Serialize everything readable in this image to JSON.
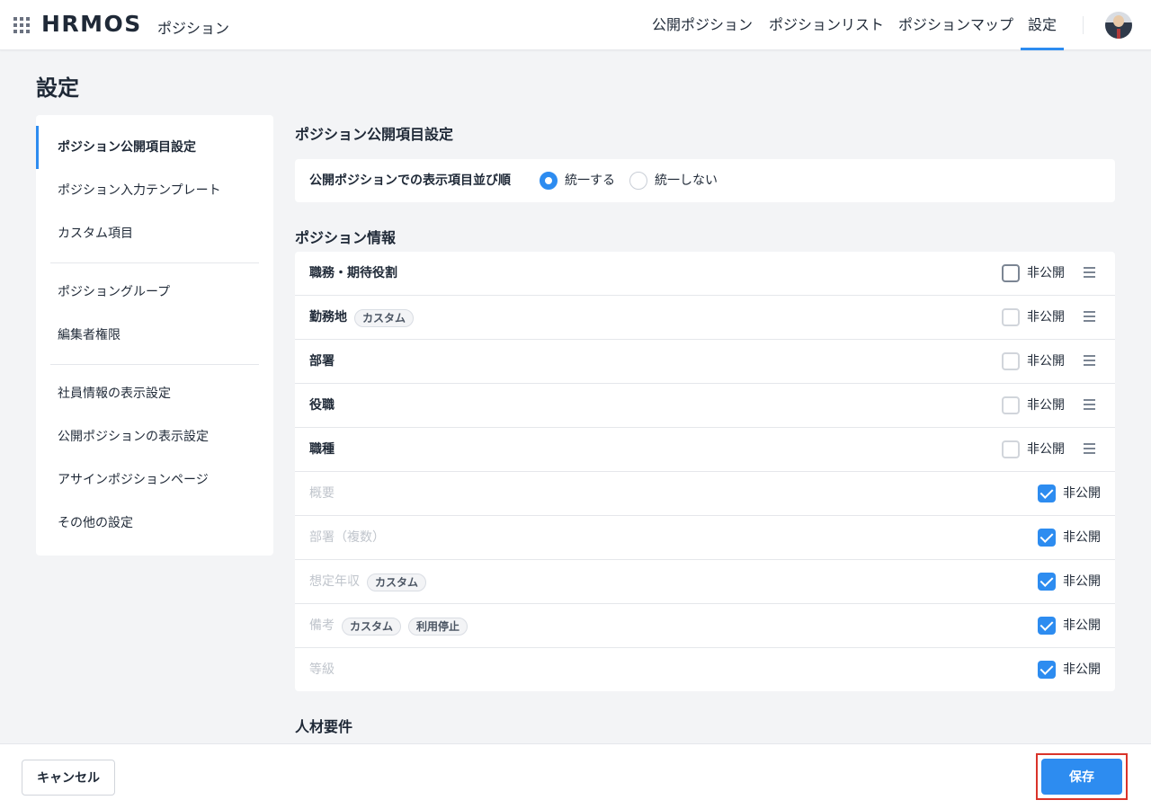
{
  "header": {
    "logo": "HRMOS",
    "app_name": "ポジション",
    "nav": [
      {
        "label": "公開ポジション",
        "active": false
      },
      {
        "label": "ポジションリスト",
        "active": false
      },
      {
        "label": "ポジションマップ",
        "active": false
      },
      {
        "label": "設定",
        "active": true
      }
    ]
  },
  "page_title": "設定",
  "sidebar": {
    "items": [
      {
        "label": "ポジション公開項目設定",
        "active": true
      },
      {
        "label": "ポジション入力テンプレート"
      },
      {
        "label": "カスタム項目"
      },
      {
        "label": "ポジショングループ"
      },
      {
        "label": "編集者権限"
      },
      {
        "label": "社員情報の表示設定"
      },
      {
        "label": "公開ポジションの表示設定"
      },
      {
        "label": "アサインポジションページ"
      },
      {
        "label": "その他の設定"
      }
    ]
  },
  "main": {
    "section_title": "ポジション公開項目設定",
    "order": {
      "label": "公開ポジションでの表示項目並び順",
      "options": [
        {
          "label": "統一する",
          "selected": true
        },
        {
          "label": "統一しない",
          "selected": false
        }
      ]
    },
    "position_info": {
      "title": "ポジション情報",
      "hidden_label": "非公開",
      "rows": [
        {
          "label": "職務・期待役割",
          "tags": [],
          "hidden": false,
          "disabled": false
        },
        {
          "label": "勤務地",
          "tags": [
            "カスタム"
          ],
          "hidden": false,
          "disabled": false
        },
        {
          "label": "部署",
          "tags": [],
          "hidden": false,
          "disabled": false
        },
        {
          "label": "役職",
          "tags": [],
          "hidden": false,
          "disabled": false
        },
        {
          "label": "職種",
          "tags": [],
          "hidden": false,
          "disabled": false
        },
        {
          "label": "概要",
          "tags": [],
          "hidden": true,
          "disabled": true
        },
        {
          "label": "部署（複数）",
          "tags": [],
          "hidden": true,
          "disabled": true
        },
        {
          "label": "想定年収",
          "tags": [
            "カスタム"
          ],
          "hidden": true,
          "disabled": true
        },
        {
          "label": "備考",
          "tags": [
            "カスタム",
            "利用停止"
          ],
          "hidden": true,
          "disabled": true
        },
        {
          "label": "等級",
          "tags": [],
          "hidden": true,
          "disabled": true
        }
      ]
    },
    "talent_title": "人材要件"
  },
  "footer": {
    "cancel_label": "キャンセル",
    "save_label": "保存"
  },
  "colors": {
    "accent": "#2d8cf0",
    "highlight": "#d9332a"
  }
}
